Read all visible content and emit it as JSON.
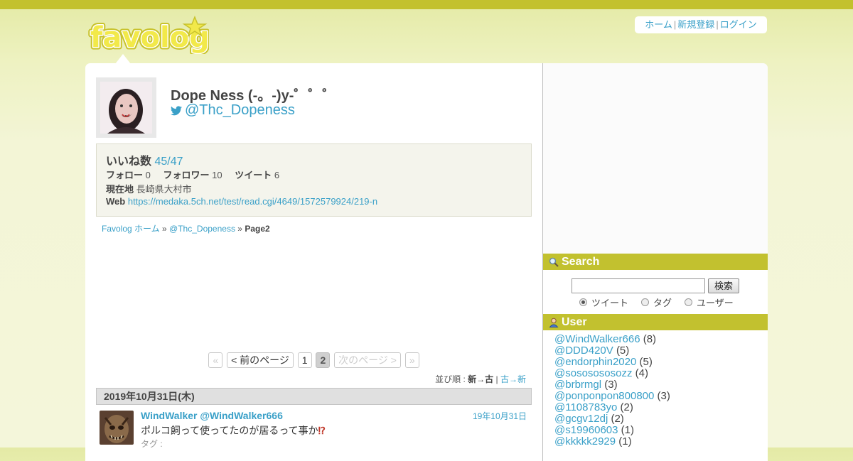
{
  "site": {
    "logo_text": "favolog",
    "nav": [
      {
        "label": "ホーム"
      },
      {
        "label": "新規登録"
      },
      {
        "label": "ログイン"
      }
    ],
    "accent": "#c3c12e",
    "link_color": "#3aa0c8"
  },
  "profile": {
    "name": "Dope Ness (-。-)y-゜゜゜",
    "handle": "@Thc_Dopeness",
    "handle_icon": "twitter-bird-icon",
    "likes_label": "いいね数",
    "likes_value": "45/47",
    "follow_label": "フォロー",
    "follow_value": "0",
    "follower_label": "フォロワー",
    "follower_value": "10",
    "tweet_label": "ツイート",
    "tweet_value": "6",
    "location_label": "現在地",
    "location_value": "長崎県大村市",
    "web_label": "Web",
    "web_value": "https://medaka.5ch.net/test/read.cgi/4649/1572579924/219-n"
  },
  "breadcrumb": {
    "home": "Favolog ホーム",
    "sep": "»",
    "user": "@Thc_Dopeness",
    "current": "Page2"
  },
  "pager": {
    "first": "«",
    "prev": "< 前のページ",
    "pages": [
      "1",
      "2"
    ],
    "current_page": "2",
    "next": "次のページ >",
    "last": "»"
  },
  "sort": {
    "label": "並び順 :",
    "active": "新→古",
    "sep": "|",
    "other": "古→新"
  },
  "feed": {
    "date_header": "2019年10月31日(木)",
    "tweets": [
      {
        "author": "WindWalker @WindWalker666",
        "time": "19年10月31日",
        "text": "ポルコ飼って使ってたのが居るって事か",
        "emoji": "⁉",
        "tags": "タグ :"
      }
    ]
  },
  "sidebar": {
    "search": {
      "title": "Search",
      "icon": "magnifier-icon",
      "button": "検索",
      "input_value": "",
      "options": [
        {
          "label": "ツイート",
          "selected": true
        },
        {
          "label": "タグ",
          "selected": false
        },
        {
          "label": "ユーザー",
          "selected": false
        }
      ]
    },
    "users": {
      "title": "User",
      "icon": "user-icon",
      "items": [
        {
          "handle": "@WindWalker666",
          "count": "(8)"
        },
        {
          "handle": "@DDD420V",
          "count": "(5)"
        },
        {
          "handle": "@endorphin2020",
          "count": "(5)"
        },
        {
          "handle": "@sososososozz",
          "count": "(4)"
        },
        {
          "handle": "@brbrmgl",
          "count": "(3)"
        },
        {
          "handle": "@ponponpon800800",
          "count": "(3)"
        },
        {
          "handle": "@1108783yo",
          "count": "(2)"
        },
        {
          "handle": "@gcgv12dj",
          "count": "(2)"
        },
        {
          "handle": "@s19960603",
          "count": "(1)"
        },
        {
          "handle": "@kkkkk2929",
          "count": "(1)"
        }
      ]
    }
  }
}
